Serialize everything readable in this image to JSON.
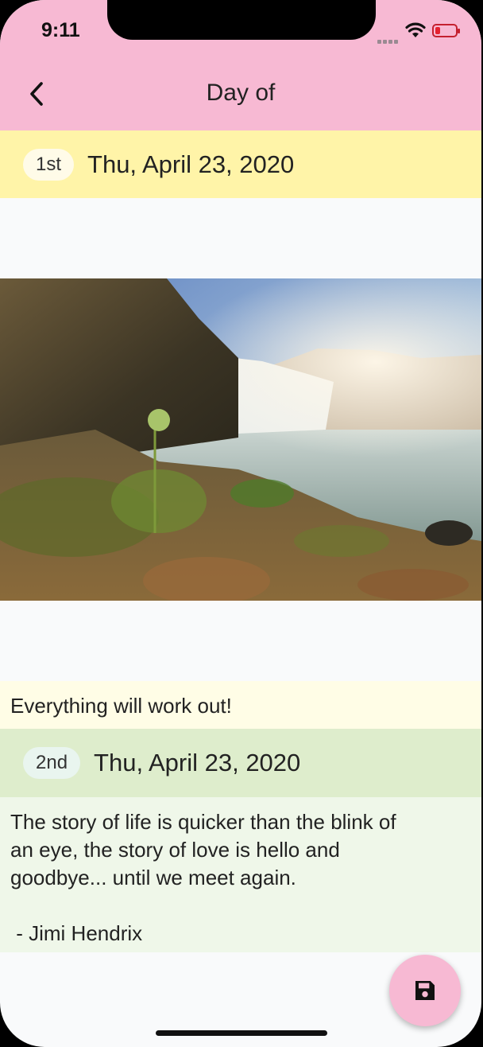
{
  "status_bar": {
    "time": "9:11"
  },
  "app_bar": {
    "title": "Day of"
  },
  "entries": [
    {
      "badge": "1st",
      "date": "Thu, April 23, 2020",
      "note": "Everything will work out!",
      "header_color": "#fff4a8",
      "badge_color": "#fffbe8",
      "note_color": "#fffde6"
    },
    {
      "badge": "2nd",
      "date": "Thu, April 23, 2020",
      "note_lines": [
        "The story of life is quicker than the blink of",
        "an eye, the story of love is hello and",
        "goodbye... until we meet again.",
        "",
        " - Jimi Hendrix"
      ],
      "header_color": "#deedcc",
      "badge_color": "#e9f5ef",
      "note_color": "#eff7e9"
    }
  ],
  "fab": {
    "icon": "save-icon",
    "color": "#f7b9d3"
  }
}
